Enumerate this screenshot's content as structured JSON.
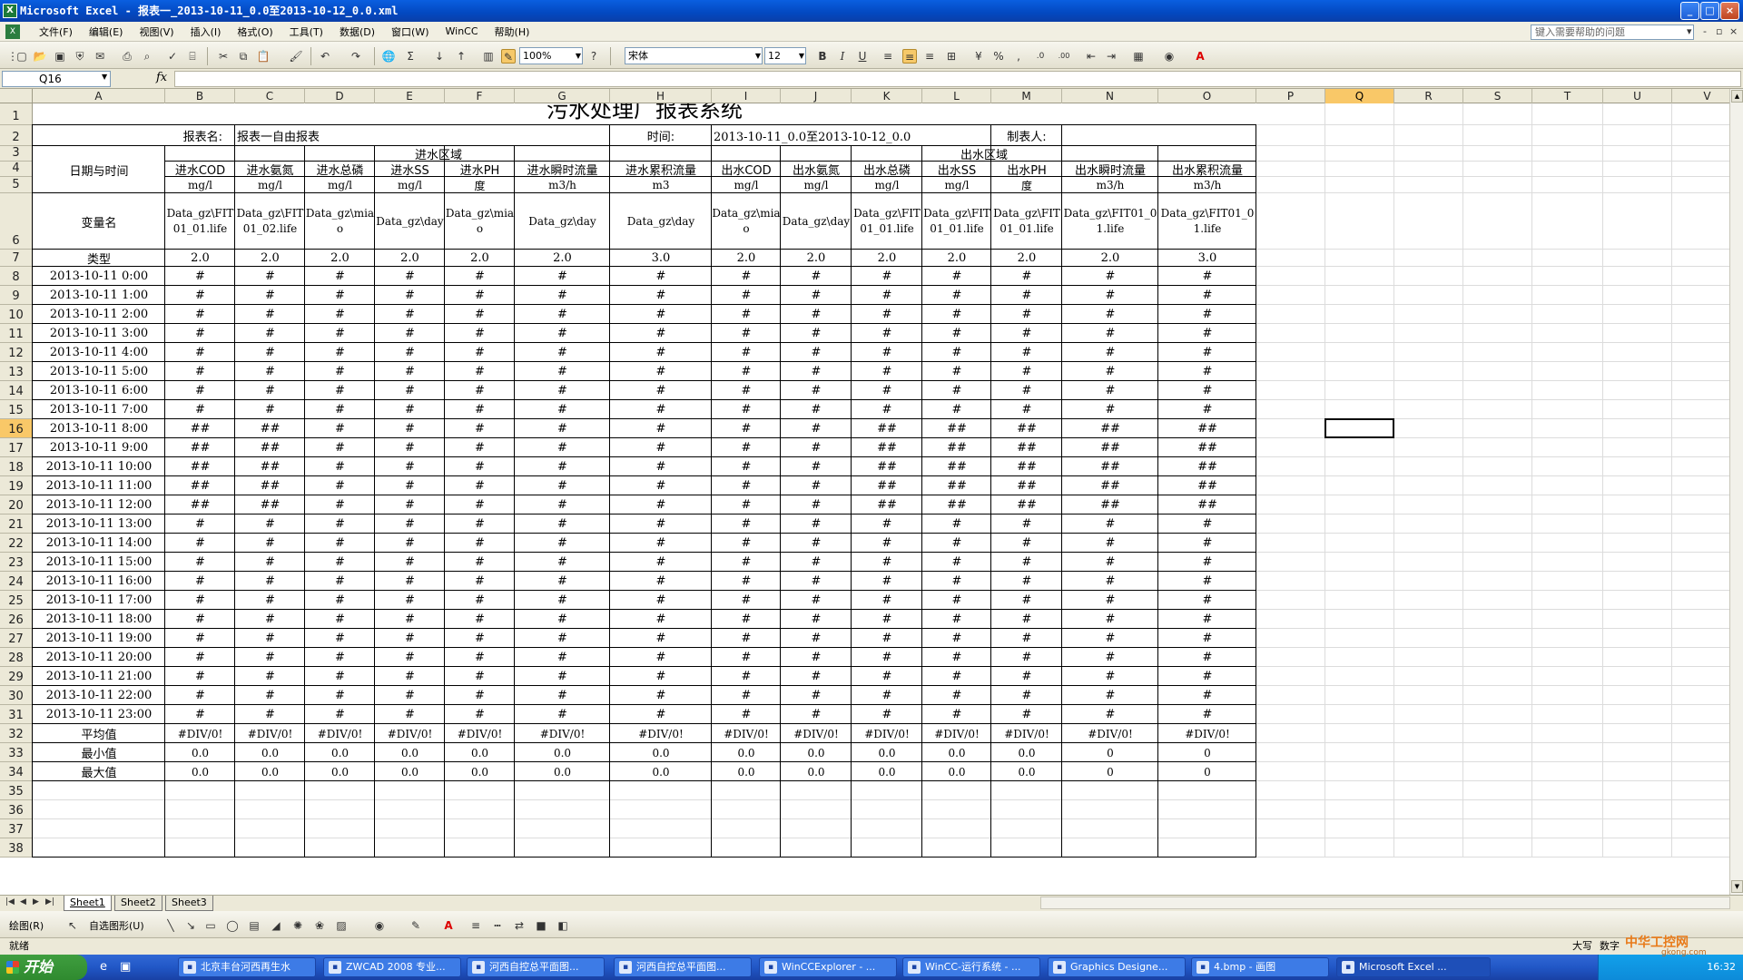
{
  "window": {
    "title": "Microsoft Excel - 报表一_2013-10-11_0.0至2013-10-12_0.0.xml",
    "app_icon": "X"
  },
  "menu": [
    "文件(F)",
    "编辑(E)",
    "视图(V)",
    "插入(I)",
    "格式(O)",
    "工具(T)",
    "数据(D)",
    "窗口(W)",
    "WinCC",
    "帮助(H)"
  ],
  "help_placeholder": "键入需要帮助的问题",
  "toolbar": {
    "zoom": "100%",
    "font": "宋体",
    "font_size": "12",
    "bold": "B",
    "italic": "I",
    "underline": "U",
    "percent": "%",
    "comma": ",",
    "inc_dec": ".0",
    "dec_dec": ".00",
    "sum": "Σ"
  },
  "formula_bar": {
    "name_box": "Q16",
    "fx": "fx",
    "content": ""
  },
  "columns": [
    "A",
    "B",
    "C",
    "D",
    "E",
    "F",
    "G",
    "H",
    "I",
    "J",
    "K",
    "L",
    "M",
    "N",
    "O",
    "P",
    "Q",
    "R",
    "S",
    "T",
    "U",
    "V"
  ],
  "selected_column": "Q",
  "rows": [
    "1",
    "2",
    "3",
    "4",
    "5",
    "6",
    "7",
    "8",
    "9",
    "10",
    "11",
    "12",
    "13",
    "14",
    "15",
    "16",
    "17",
    "18",
    "19",
    "20",
    "21",
    "22",
    "23",
    "24",
    "25",
    "26",
    "27",
    "28",
    "29",
    "30",
    "31",
    "32",
    "33",
    "34",
    "35",
    "36",
    "37",
    "38"
  ],
  "selected_row": "16",
  "report": {
    "title": "污水处理厂报表系统",
    "name_label": "报表名:",
    "name_value": "报表一自由报表",
    "time_label": "时间:",
    "time_value": "2013-10-11_0.0至2013-10-12_0.0",
    "author_label": "制表人:",
    "inlet_area": "进水区域",
    "outlet_area": "出水区域",
    "datetime_label": "日期与时间",
    "var_label": "变量名",
    "type_label": "类型",
    "headers": [
      "进水COD",
      "进水氨氮",
      "进水总磷",
      "进水SS",
      "进水PH",
      "进水瞬时流量",
      "进水累积流量",
      "出水COD",
      "出水氨氮",
      "出水总磷",
      "出水SS",
      "出水PH",
      "出水瞬时流量",
      "出水累积流量"
    ],
    "units": [
      "mg/l",
      "mg/l",
      "mg/l",
      "mg/l",
      "度",
      "m3/h",
      "m3",
      "mg/l",
      "mg/l",
      "mg/l",
      "mg/l",
      "度",
      "m3/h",
      "m3/h"
    ],
    "varnames": [
      "Data_gz\\FIT01_01.life",
      "Data_gz\\FIT01_02.life",
      "Data_gz\\miao",
      "Data_gz\\day",
      "Data_gz\\miao",
      "Data_gz\\day",
      "Data_gz\\day",
      "Data_gz\\miao",
      "Data_gz\\day",
      "Data_gz\\FIT01_01.life",
      "Data_gz\\FIT01_01.life",
      "Data_gz\\FIT01_01.life",
      "Data_gz\\FIT01_01.life",
      "Data_gz\\FIT01_01.life"
    ],
    "types": [
      "2.0",
      "2.0",
      "2.0",
      "2.0",
      "2.0",
      "2.0",
      "3.0",
      "2.0",
      "2.0",
      "2.0",
      "2.0",
      "2.0",
      "2.0",
      "3.0"
    ],
    "data_rows": [
      {
        "time": "2013-10-11 0:00",
        "v": [
          "#",
          "#",
          "#",
          "#",
          "#",
          "#",
          "#",
          "#",
          "#",
          "#",
          "#",
          "#",
          "#",
          "#"
        ]
      },
      {
        "time": "2013-10-11 1:00",
        "v": [
          "#",
          "#",
          "#",
          "#",
          "#",
          "#",
          "#",
          "#",
          "#",
          "#",
          "#",
          "#",
          "#",
          "#"
        ]
      },
      {
        "time": "2013-10-11 2:00",
        "v": [
          "#",
          "#",
          "#",
          "#",
          "#",
          "#",
          "#",
          "#",
          "#",
          "#",
          "#",
          "#",
          "#",
          "#"
        ]
      },
      {
        "time": "2013-10-11 3:00",
        "v": [
          "#",
          "#",
          "#",
          "#",
          "#",
          "#",
          "#",
          "#",
          "#",
          "#",
          "#",
          "#",
          "#",
          "#"
        ]
      },
      {
        "time": "2013-10-11 4:00",
        "v": [
          "#",
          "#",
          "#",
          "#",
          "#",
          "#",
          "#",
          "#",
          "#",
          "#",
          "#",
          "#",
          "#",
          "#"
        ]
      },
      {
        "time": "2013-10-11 5:00",
        "v": [
          "#",
          "#",
          "#",
          "#",
          "#",
          "#",
          "#",
          "#",
          "#",
          "#",
          "#",
          "#",
          "#",
          "#"
        ]
      },
      {
        "time": "2013-10-11 6:00",
        "v": [
          "#",
          "#",
          "#",
          "#",
          "#",
          "#",
          "#",
          "#",
          "#",
          "#",
          "#",
          "#",
          "#",
          "#"
        ]
      },
      {
        "time": "2013-10-11 7:00",
        "v": [
          "#",
          "#",
          "#",
          "#",
          "#",
          "#",
          "#",
          "#",
          "#",
          "#",
          "#",
          "#",
          "#",
          "#"
        ]
      },
      {
        "time": "2013-10-11 8:00",
        "v": [
          "##",
          "##",
          "#",
          "#",
          "#",
          "#",
          "#",
          "#",
          "#",
          "##",
          "##",
          "##",
          "##",
          "##"
        ]
      },
      {
        "time": "2013-10-11 9:00",
        "v": [
          "##",
          "##",
          "#",
          "#",
          "#",
          "#",
          "#",
          "#",
          "#",
          "##",
          "##",
          "##",
          "##",
          "##"
        ]
      },
      {
        "time": "2013-10-11 10:00",
        "v": [
          "##",
          "##",
          "#",
          "#",
          "#",
          "#",
          "#",
          "#",
          "#",
          "##",
          "##",
          "##",
          "##",
          "##"
        ]
      },
      {
        "time": "2013-10-11 11:00",
        "v": [
          "##",
          "##",
          "#",
          "#",
          "#",
          "#",
          "#",
          "#",
          "#",
          "##",
          "##",
          "##",
          "##",
          "##"
        ]
      },
      {
        "time": "2013-10-11 12:00",
        "v": [
          "##",
          "##",
          "#",
          "#",
          "#",
          "#",
          "#",
          "#",
          "#",
          "##",
          "##",
          "##",
          "##",
          "##"
        ]
      },
      {
        "time": "2013-10-11 13:00",
        "v": [
          "#",
          "#",
          "#",
          "#",
          "#",
          "#",
          "#",
          "#",
          "#",
          "#",
          "#",
          "#",
          "#",
          "#"
        ]
      },
      {
        "time": "2013-10-11 14:00",
        "v": [
          "#",
          "#",
          "#",
          "#",
          "#",
          "#",
          "#",
          "#",
          "#",
          "#",
          "#",
          "#",
          "#",
          "#"
        ]
      },
      {
        "time": "2013-10-11 15:00",
        "v": [
          "#",
          "#",
          "#",
          "#",
          "#",
          "#",
          "#",
          "#",
          "#",
          "#",
          "#",
          "#",
          "#",
          "#"
        ]
      },
      {
        "time": "2013-10-11 16:00",
        "v": [
          "#",
          "#",
          "#",
          "#",
          "#",
          "#",
          "#",
          "#",
          "#",
          "#",
          "#",
          "#",
          "#",
          "#"
        ]
      },
      {
        "time": "2013-10-11 17:00",
        "v": [
          "#",
          "#",
          "#",
          "#",
          "#",
          "#",
          "#",
          "#",
          "#",
          "#",
          "#",
          "#",
          "#",
          "#"
        ]
      },
      {
        "time": "2013-10-11 18:00",
        "v": [
          "#",
          "#",
          "#",
          "#",
          "#",
          "#",
          "#",
          "#",
          "#",
          "#",
          "#",
          "#",
          "#",
          "#"
        ]
      },
      {
        "time": "2013-10-11 19:00",
        "v": [
          "#",
          "#",
          "#",
          "#",
          "#",
          "#",
          "#",
          "#",
          "#",
          "#",
          "#",
          "#",
          "#",
          "#"
        ]
      },
      {
        "time": "2013-10-11 20:00",
        "v": [
          "#",
          "#",
          "#",
          "#",
          "#",
          "#",
          "#",
          "#",
          "#",
          "#",
          "#",
          "#",
          "#",
          "#"
        ]
      },
      {
        "time": "2013-10-11 21:00",
        "v": [
          "#",
          "#",
          "#",
          "#",
          "#",
          "#",
          "#",
          "#",
          "#",
          "#",
          "#",
          "#",
          "#",
          "#"
        ]
      },
      {
        "time": "2013-10-11 22:00",
        "v": [
          "#",
          "#",
          "#",
          "#",
          "#",
          "#",
          "#",
          "#",
          "#",
          "#",
          "#",
          "#",
          "#",
          "#"
        ]
      },
      {
        "time": "2013-10-11 23:00",
        "v": [
          "#",
          "#",
          "#",
          "#",
          "#",
          "#",
          "#",
          "#",
          "#",
          "#",
          "#",
          "#",
          "#",
          "#"
        ]
      }
    ],
    "summary_rows": [
      {
        "label": "平均值",
        "v": [
          "#DIV/0!",
          "#DIV/0!",
          "#DIV/0!",
          "#DIV/0!",
          "#DIV/0!",
          "#DIV/0!",
          "#DIV/0!",
          "#DIV/0!",
          "#DIV/0!",
          "#DIV/0!",
          "#DIV/0!",
          "#DIV/0!",
          "#DIV/0!",
          "#DIV/0!"
        ]
      },
      {
        "label": "最小值",
        "v": [
          "0.0",
          "0.0",
          "0.0",
          "0.0",
          "0.0",
          "0.0",
          "0.0",
          "0.0",
          "0.0",
          "0.0",
          "0.0",
          "0.0",
          "0",
          "0"
        ]
      },
      {
        "label": "最大值",
        "v": [
          "0.0",
          "0.0",
          "0.0",
          "0.0",
          "0.0",
          "0.0",
          "0.0",
          "0.0",
          "0.0",
          "0.0",
          "0.0",
          "0.0",
          "0",
          "0"
        ]
      }
    ]
  },
  "sheet_tabs": [
    "Sheet1",
    "Sheet2",
    "Sheet3"
  ],
  "active_sheet": "Sheet1",
  "drawbar": {
    "draw_label": "绘图(R)",
    "autoshape_label": "自选图形(U)"
  },
  "status": {
    "left": "就绪",
    "caps": "大写",
    "num": "数字"
  },
  "taskbar": {
    "start": "开始",
    "items": [
      "北京丰台河西再生水",
      "ZWCAD 2008 专业...",
      "河西自控总平面图...",
      "河西自控总平面图...",
      "WinCCExplorer - ...",
      "WinCC-运行系统 - ...",
      "Graphics Designe...",
      "4.bmp - 画图",
      "Microsoft Excel ..."
    ],
    "active_index": 8,
    "clock": "16:32"
  },
  "watermark": {
    "brand": "中华工控网",
    "site": "gkong.com"
  },
  "colors": {
    "selection": "#f9c868",
    "titlebar": "#0a5fe0",
    "taskbar": "#2157c6"
  }
}
